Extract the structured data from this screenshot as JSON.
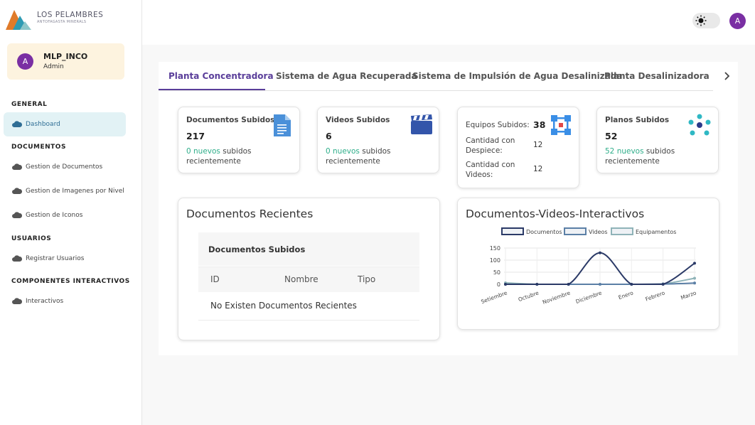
{
  "brand": {
    "name": "LOS PELAMBRES",
    "subtitle": "ANTOFAGASTA MINERALS"
  },
  "user": {
    "initial": "A",
    "name": "MLP_INCO",
    "role": "Admin"
  },
  "topbar": {
    "avatar_initial": "A"
  },
  "sidebar": {
    "sections": [
      {
        "title": "GENERAL"
      },
      {
        "title": "DOCUMENTOS"
      },
      {
        "title": "USUARIOS"
      },
      {
        "title": "COMPONENTES INTERACTIVOS"
      }
    ],
    "items": [
      {
        "label": "Dashboard"
      },
      {
        "label": "Gestion de Documentos"
      },
      {
        "label": "Gestion de Imagenes por Nivel"
      },
      {
        "label": "Gestion de Iconos"
      },
      {
        "label": "Registrar Usuarios"
      },
      {
        "label": "Interactivos"
      }
    ]
  },
  "tabs": [
    {
      "label": "Planta Concentradora"
    },
    {
      "label": "Sistema de Agua Recuperada"
    },
    {
      "label": "Sistema de Impulsión de Agua Desalinizada"
    },
    {
      "label": "Planta Desalinizadora"
    }
  ],
  "cards": {
    "documentos": {
      "title": "Documentos Subidos",
      "count": "217",
      "new": "0 nuevos",
      "suffix": "subidos recientemente"
    },
    "videos": {
      "title": "Videos Subidos",
      "count": "6",
      "new": "0 nuevos",
      "suffix": "subidos recientemente"
    },
    "equipos": {
      "label": "Equipos Subidos:",
      "count": "38",
      "despiece_label": "Cantidad con Despiece:",
      "despiece_value": "12",
      "videos_label": "Cantidad con Videos:",
      "videos_value": "12"
    },
    "planos": {
      "title": "Planos Subidos",
      "count": "52",
      "new": "52 nuevos",
      "suffix": "subidos recientemente"
    }
  },
  "recent": {
    "title": "Documentos Recientes",
    "table_title": "Documentos Subidos",
    "columns": [
      "ID",
      "Nombre",
      "Tipo"
    ],
    "empty": "No Existen Documentos Recientes"
  },
  "chart_panel": {
    "title": "Documentos-Videos-Interactivos"
  },
  "chart_data": {
    "type": "line",
    "categories": [
      "Setiembre",
      "Octubre",
      "Noviembre",
      "Diciembre",
      "Enero",
      "Febrero",
      "Marzo"
    ],
    "series": [
      {
        "name": "Documentos",
        "color": "#2b3a67",
        "values": [
          0,
          0,
          0,
          130,
          0,
          0,
          87
        ]
      },
      {
        "name": "Videos",
        "color": "#5b7fa6",
        "values": [
          0,
          0,
          0,
          0,
          0,
          1,
          5
        ]
      },
      {
        "name": "Equipamentos",
        "color": "#8fb3b8",
        "values": [
          6,
          0,
          0,
          0,
          0,
          2,
          25
        ]
      }
    ],
    "ylim": [
      0,
      150
    ],
    "yticks": [
      0,
      50,
      100,
      150
    ],
    "legend": "top",
    "grid": true
  }
}
